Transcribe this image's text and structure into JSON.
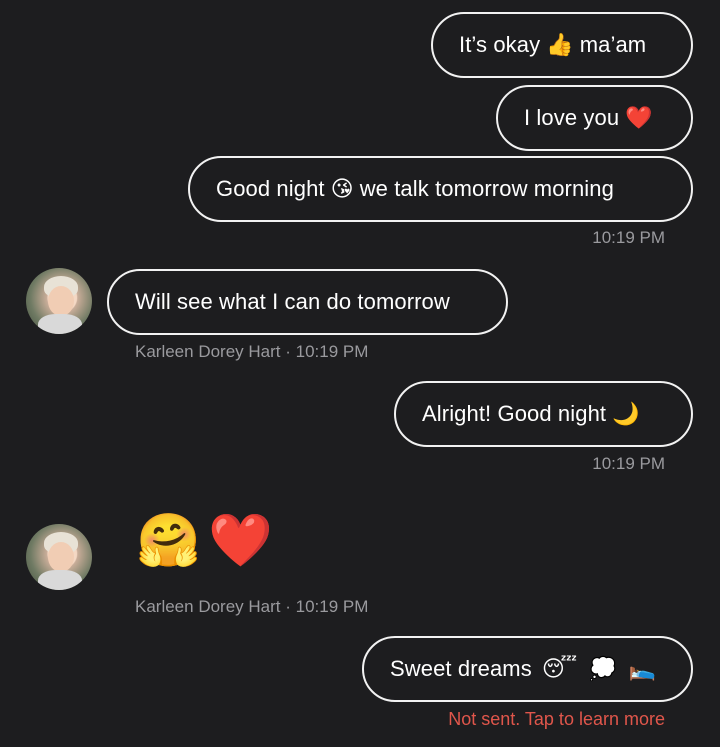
{
  "messages": [
    {
      "id": "m1",
      "text_before": "It’s okay",
      "emoji": "👍",
      "text_after": "ma’am"
    },
    {
      "id": "m2",
      "text_before": "I love you",
      "emoji": "❤️",
      "text_after": ""
    },
    {
      "id": "m3",
      "text_before": "Good night",
      "emoji": "😘",
      "text_after": "we talk tomorrow morning"
    },
    {
      "id": "m4",
      "text_before": "Will see what I can do tomorrow",
      "emoji": "",
      "text_after": ""
    },
    {
      "id": "m5",
      "text_before": "Alright! Good night",
      "emoji": "🌙",
      "text_after": ""
    },
    {
      "id": "m6",
      "emoji_hug": "🤗",
      "emoji_heart": "❤️"
    },
    {
      "id": "m7",
      "text_before": "Sweet dreams",
      "emoji": "😴",
      "emoji2": "💭",
      "emoji3": "🛌"
    }
  ],
  "timestamps": {
    "t1": "10:19 PM",
    "t2": "10:19 PM",
    "t3": "10:19 PM"
  },
  "sender": {
    "name_line_1": "Karleen Dorey Hart · 10:19 PM",
    "name_line_2": "Karleen Dorey Hart · 10:19 PM"
  },
  "status": {
    "not_sent": "Not sent. Tap to learn more"
  },
  "colors": {
    "background": "#1d1d1f",
    "bubble_border": "#f2f2f2",
    "meta_text": "#9a9a9e",
    "error_text": "#e0564b"
  }
}
